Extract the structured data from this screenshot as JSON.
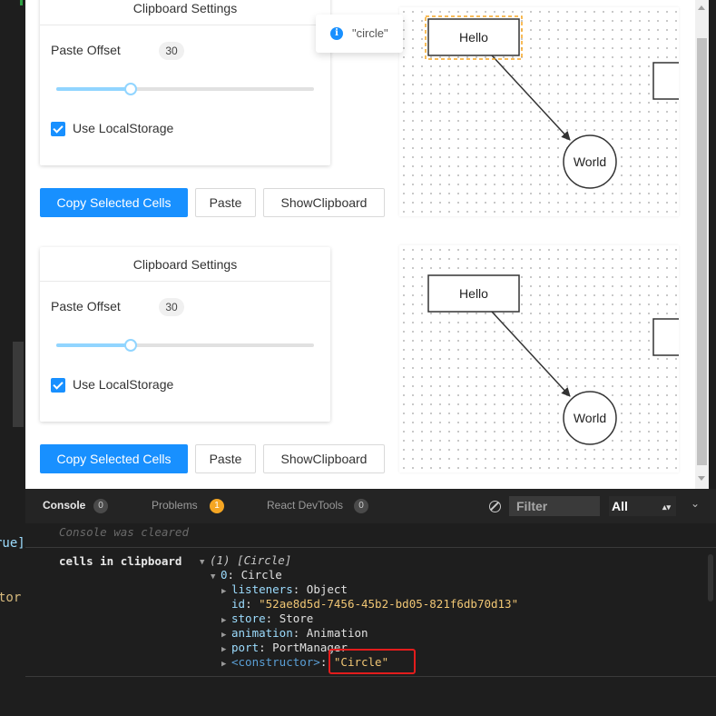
{
  "editor": {
    "fragment_top": "rue]",
    "fragment_bottom": "tor"
  },
  "panels": [
    {
      "settings_title": "Clipboard Settings",
      "paste_offset_label": "Paste Offset",
      "paste_offset_value": "30",
      "slider_fraction": 0.29,
      "use_localstorage_label": "Use LocalStorage",
      "use_localstorage_checked": true,
      "buttons": {
        "copy": "Copy Selected Cells",
        "paste": "Paste",
        "show": "ShowClipboard"
      },
      "graph": {
        "rect_label": "Hello",
        "circle_label": "World",
        "rect_selected": true
      }
    },
    {
      "settings_title": "Clipboard Settings",
      "paste_offset_label": "Paste Offset",
      "paste_offset_value": "30",
      "slider_fraction": 0.29,
      "use_localstorage_label": "Use LocalStorage",
      "use_localstorage_checked": true,
      "buttons": {
        "copy": "Copy Selected Cells",
        "paste": "Paste",
        "show": "ShowClipboard"
      },
      "graph": {
        "rect_label": "Hello",
        "circle_label": "World",
        "rect_selected": false
      }
    }
  ],
  "tooltip": {
    "text": "\"circle\"",
    "icon": "info-icon"
  },
  "console": {
    "tabs": [
      {
        "label": "Console",
        "count": "0",
        "active": true
      },
      {
        "label": "Problems",
        "count": "1",
        "active": false
      },
      {
        "label": "React DevTools",
        "count": "0",
        "active": false
      }
    ],
    "filter_placeholder": "Filter",
    "level": "All",
    "cleared_message": "Console was cleared",
    "log_label": "cells in clipboard",
    "tree": {
      "root": "(1) [Circle]",
      "item_key": "0",
      "item_value": "Circle",
      "props": [
        {
          "key": "listeners",
          "value": "Object",
          "expandable": true
        },
        {
          "key": "id",
          "value": "\"52ae8d5d-7456-45b2-bd05-821f6db70d13\"",
          "expandable": false
        },
        {
          "key": "store",
          "value": "Store",
          "expandable": true
        },
        {
          "key": "animation",
          "value": "Animation",
          "expandable": true
        },
        {
          "key": "port",
          "value": "PortManager",
          "expandable": true
        },
        {
          "key": "<constructor>",
          "value": "\"Circle\"",
          "expandable": true
        }
      ]
    }
  },
  "colors": {
    "primary": "#1890ff",
    "highlight": "#e31c1c",
    "warn": "#f5a623"
  }
}
